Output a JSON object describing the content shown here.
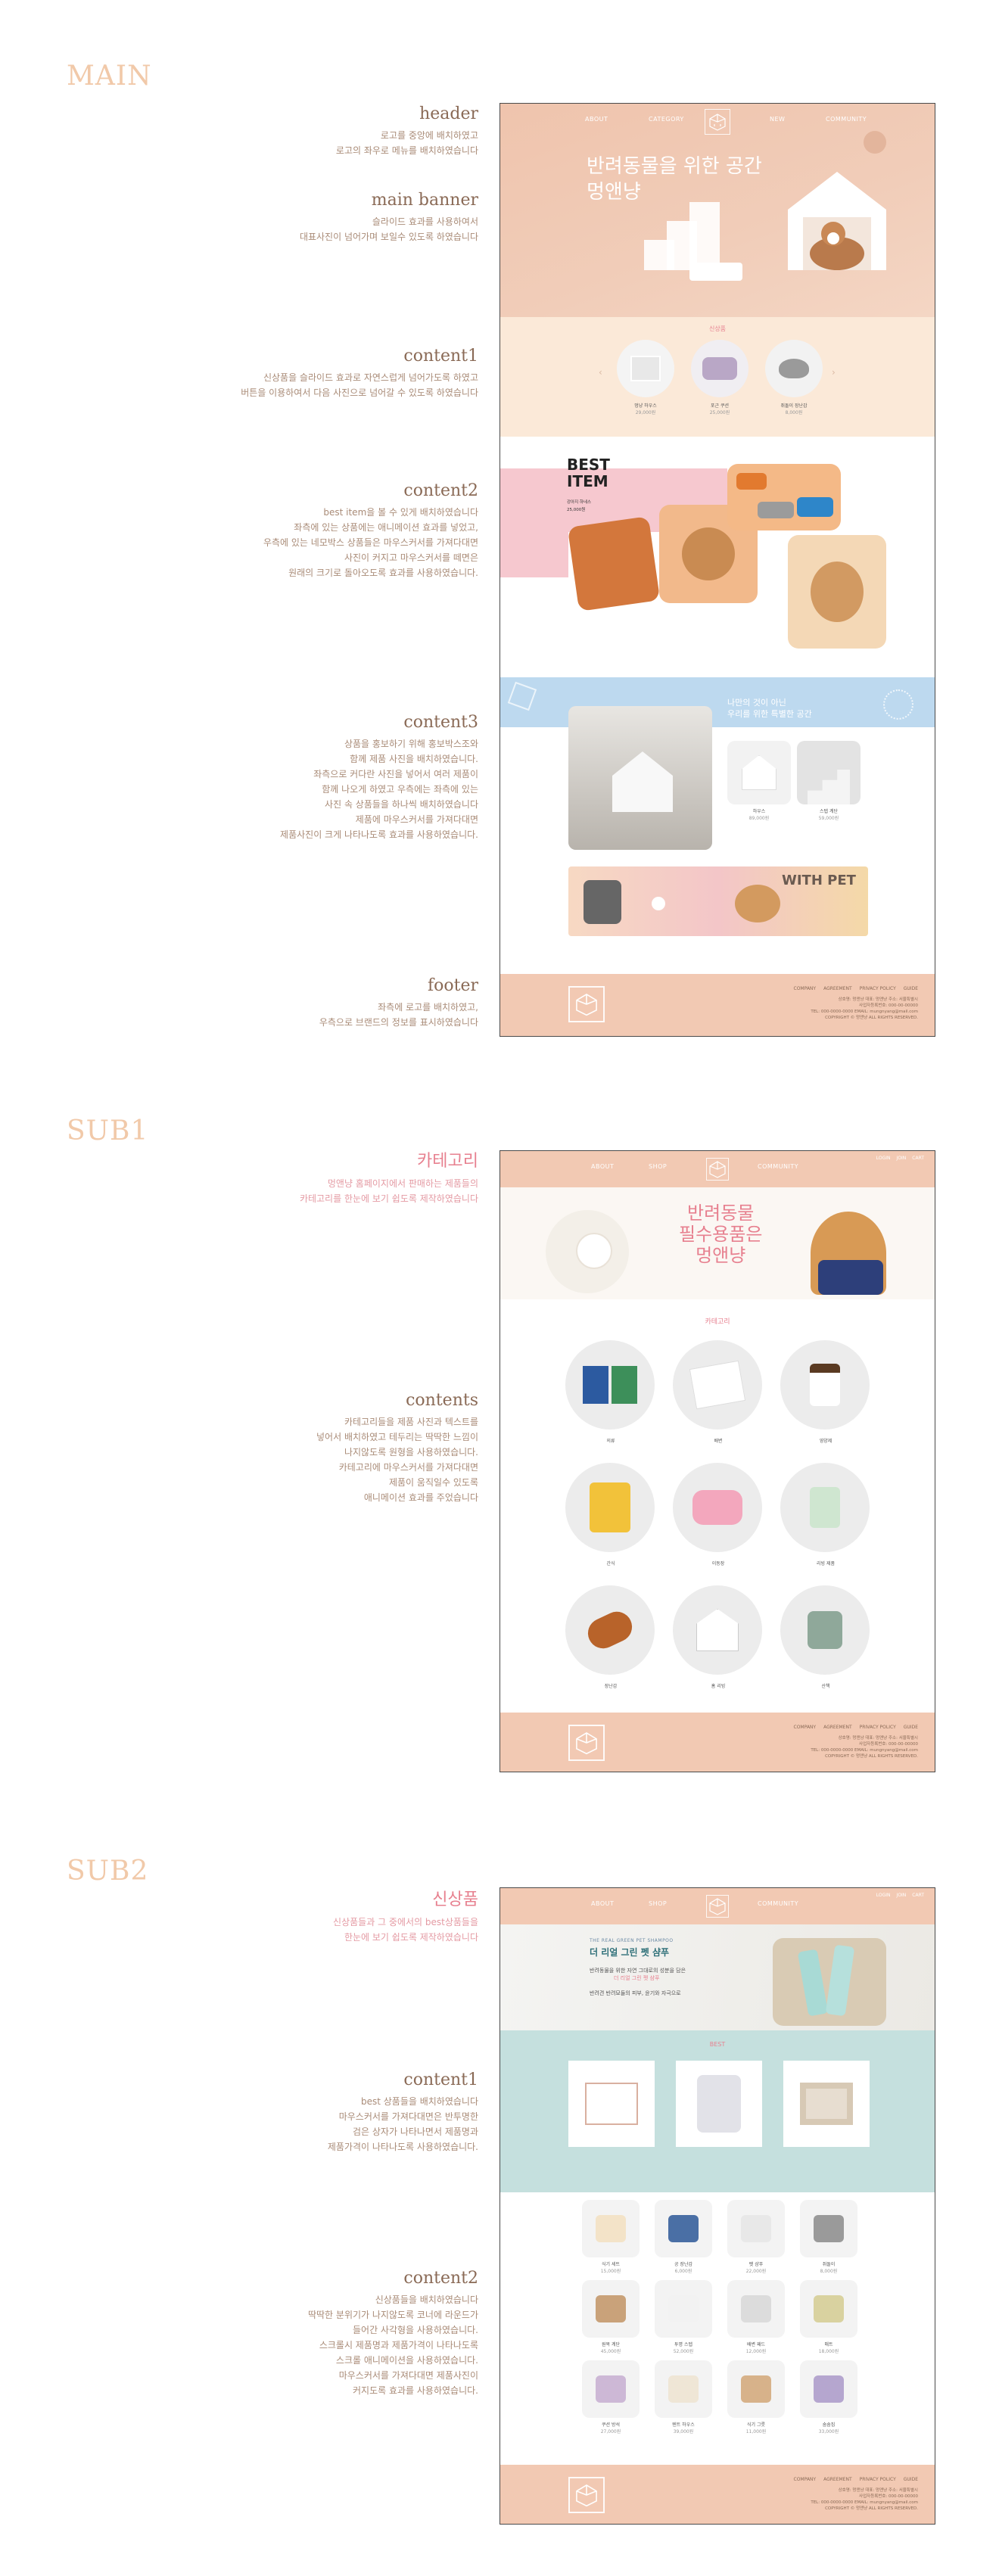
{
  "sections": {
    "main": "MAIN",
    "sub1": "SUB1",
    "sub2": "SUB2"
  },
  "annotations": {
    "main_header": {
      "title": "header",
      "lines": [
        "로고를 중앙에 배치하였고",
        "로고의 좌우로 메뉴를 배치하였습니다"
      ]
    },
    "main_banner": {
      "title": "main banner",
      "lines": [
        "슬라이드 효과를 사용하여서",
        "대표사진이 넘어가며 보일수 있도록 하였습니다"
      ]
    },
    "main_content1": {
      "title": "content1",
      "lines": [
        "신상품을 슬라이드 효과로 자연스럽게 넘어가도록 하였고",
        "버튼을 이용하여서 다음 사진으로 넘어갈 수 있도록 하였습니다"
      ]
    },
    "main_content2": {
      "title": "content2",
      "lines": [
        "best item을 볼 수 있게 배치하였습니다",
        "좌측에 있는 상품에는 애니메이션 효과를 넣었고,",
        "우측에 있는 네모박스 상품들은 마우스커서를 가져다대면",
        "사진이 커지고 마우스커서를 떼면은",
        "원래의 크기로 돌아오도록 효과를 사용하였습니다."
      ]
    },
    "main_content3": {
      "title": "content3",
      "lines": [
        "상품을 홍보하기 위해 홍보박스조와",
        "함께 제품 사진을 배치하였습니다.",
        "좌측으로 커다란 사진을 넣어서 여러 제품이",
        "함께 나오게 하였고 우측에는 좌측에 있는",
        "사진 속 상품들을 하나씩 배치하였습니다",
        "제품에 마우스커서를 가져다대면",
        "제품사진이 크게 나타나도록 효과를 사용하였습니다."
      ]
    },
    "main_footer": {
      "title": "footer",
      "lines": [
        "좌측에 로고를 배치하였고,",
        "우측으로 브랜드의 정보를 표시하였습니다"
      ]
    },
    "sub1_category": {
      "title": "카테고리",
      "lines": [
        "멍앤냥 홈페이지에서 판매하는 제품들의",
        "카테고리를 한눈에 보기 쉽도록 제작하였습니다"
      ]
    },
    "sub1_contents": {
      "title": "contents",
      "lines": [
        "카테고리들을 제품 사진과 텍스트를",
        "넣어서 배치하였고 테두리는 딱딱한 느낌이",
        "나지않도록 원형을 사용하였습니다.",
        "카테고리에 마우스커서를 가져다대면",
        "제품이 움직일수 있도록",
        "애니메이션 효과를 주었습니다"
      ]
    },
    "sub2_new": {
      "title": "신상품",
      "lines": [
        "신상품들과 그 중에서의 best상품들을",
        "한눈에 보기 쉽도록 제작하였습니다"
      ]
    },
    "sub2_content1": {
      "title": "content1",
      "lines": [
        "best 상품들을 배치하였습니다",
        "마우스커서를 가져다대면은 반투명한",
        "검은 상자가 나타나면서 제품명과",
        "제품가격이 나타나도록 사용하였습니다."
      ]
    },
    "sub2_content2": {
      "title": "content2",
      "lines": [
        "신상품들을 배치하였습니다",
        "딱딱한 분위기가 나지않도록 코너에 라운드가",
        "들어간 사각형을 사용하였습니다.",
        "스크롤시 제품명과 제품가격이 나타나도록",
        "스크롤 애니메이션을 사용하였습니다.",
        "마우스커서를 가져다대면 제품사진이",
        "커지도록 효과를 사용하였습니다."
      ]
    }
  },
  "main": {
    "nav": [
      "ABOUT",
      "CATEGORY",
      "NEW",
      "COMMUNITY"
    ],
    "banner_title_line1": "반려동물을 위한 공간",
    "banner_title_line2": "멍앤냥",
    "new_label": "신상품",
    "new_items": [
      {
        "name": "멍냥 하우스",
        "price": "29,000원"
      },
      {
        "name": "포근 쿠션",
        "price": "25,000원"
      },
      {
        "name": "쥐돌이 장난감",
        "price": "8,000원"
      }
    ],
    "best_title1": "BEST",
    "best_title2": "ITEM",
    "best_desc": "강아지 하네스",
    "best_price": "25,000원",
    "promo_line1": "나만의 것이 아닌",
    "promo_line2": "우리를 위한 특별한 공간",
    "promo_items": [
      {
        "name": "하우스",
        "price": "89,000원"
      },
      {
        "name": "스텝 계단",
        "price": "59,000원"
      }
    ],
    "with_pet": "WITH PET",
    "footer_menu": [
      "COMPANY",
      "AGREEMENT",
      "PRIVACY POLICY",
      "GUIDE"
    ],
    "footer_info": [
      "상호명: 멍앤냥  대표: 멍앤냥  주소: 서울특별시",
      "사업자등록번호: 000-00-00000",
      "TEL: 000-0000-0000  EMAIL: mungnyang@mail.com",
      "COPYRIGHT © 멍앤냥 ALL RIGHTS RESERVED."
    ]
  },
  "sub1": {
    "nav": [
      "ABOUT",
      "SHOP",
      "COMMUNITY"
    ],
    "util": [
      "LOGIN",
      "JOIN",
      "CART"
    ],
    "banner_line1": "반려동물",
    "banner_line2": "필수용품은",
    "banner_line3": "멍앤냥",
    "category_title": "카테고리",
    "categories": [
      "의류",
      "배변",
      "영양제",
      "간식",
      "이동장",
      "리빙 제품",
      "장난감",
      "홈 리빙",
      "산책"
    ]
  },
  "sub2": {
    "nav": [
      "ABOUT",
      "SHOP",
      "COMMUNITY"
    ],
    "util": [
      "LOGIN",
      "JOIN",
      "CART"
    ],
    "banner_small": "THE REAL GREEN PET SHAMPOO",
    "banner_title": "더 리얼 그린 펫 샴푸",
    "banner_line1": "반려동물을 위한 자연 그대로의 성분을 담은",
    "banner_line2": "더 리얼 그린 펫 샴푸",
    "banner_line3": "반려견 반려묘들의 피부, 윤기와 자극으로",
    "best_title": "BEST",
    "new_items": [
      {
        "name": "식기 세트",
        "price": "15,000원"
      },
      {
        "name": "공 장난감",
        "price": "6,000원"
      },
      {
        "name": "펫 샴푸",
        "price": "22,000원"
      },
      {
        "name": "쥐돌이",
        "price": "8,000원"
      },
      {
        "name": "원목 계단",
        "price": "45,000원"
      },
      {
        "name": "투명 스텝",
        "price": "52,000원"
      },
      {
        "name": "배변 패드",
        "price": "12,000원"
      },
      {
        "name": "매트",
        "price": "18,000원"
      },
      {
        "name": "쿠션 방석",
        "price": "27,000원"
      },
      {
        "name": "텐트 하우스",
        "price": "39,000원"
      },
      {
        "name": "식기 그릇",
        "price": "11,000원"
      },
      {
        "name": "숨숨집",
        "price": "33,000원"
      }
    ]
  },
  "colors": {
    "peach": "#f2c9b3",
    "cream": "#fbe9d8",
    "pink": "#f6c8cf",
    "blue": "#bdd9ef",
    "mint": "#c5e0de",
    "accent": "#e7808f"
  }
}
